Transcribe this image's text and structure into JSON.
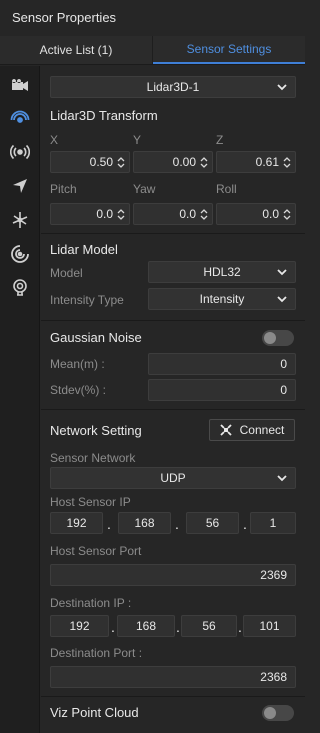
{
  "window": {
    "title": "Sensor Properties"
  },
  "tabs": {
    "active_list": "Active List  (1)",
    "sensor_settings": "Sensor Settings"
  },
  "sidebar": {
    "icons": [
      "camera-icon",
      "lidar-icon",
      "radar-icon",
      "navigation-icon",
      "imu-icon",
      "ultrasonic-icon",
      "gps-icon"
    ]
  },
  "sensor_select": {
    "value": "Lidar3D-1"
  },
  "transform": {
    "heading": "Lidar3D Transform",
    "x_label": "X",
    "y_label": "Y",
    "z_label": "Z",
    "x": "0.50",
    "y": "0.00",
    "z": "0.61",
    "pitch_label": "Pitch",
    "yaw_label": "Yaw",
    "roll_label": "Roll",
    "pitch": "0.0",
    "yaw": "0.0",
    "roll": "0.0"
  },
  "lidar_model": {
    "heading": "Lidar Model",
    "model_label": "Model",
    "model_value": "HDL32",
    "intensity_label": "Intensity Type",
    "intensity_value": "Intensity"
  },
  "noise": {
    "heading": "Gaussian Noise",
    "enabled": false,
    "mean_label": "Mean(m) :",
    "mean_value": "0",
    "stdev_label": "Stdev(%) :",
    "stdev_value": "0"
  },
  "network": {
    "heading": "Network Setting",
    "connect_label": "Connect",
    "sensor_network_label": "Sensor Network",
    "sensor_network_value": "UDP",
    "host_ip_label": "Host Sensor IP",
    "host_ip": [
      "192",
      "168",
      "56",
      "1"
    ],
    "host_port_label": "Host Sensor Port",
    "host_port": "2369",
    "dest_ip_label": "Destination IP :",
    "dest_ip": [
      "192",
      "168",
      "56",
      "101"
    ],
    "dest_port_label": "Destination Port :",
    "dest_port": "2368",
    "ip_separator": "."
  },
  "viz": {
    "label": "Viz Point Cloud",
    "enabled": false
  }
}
